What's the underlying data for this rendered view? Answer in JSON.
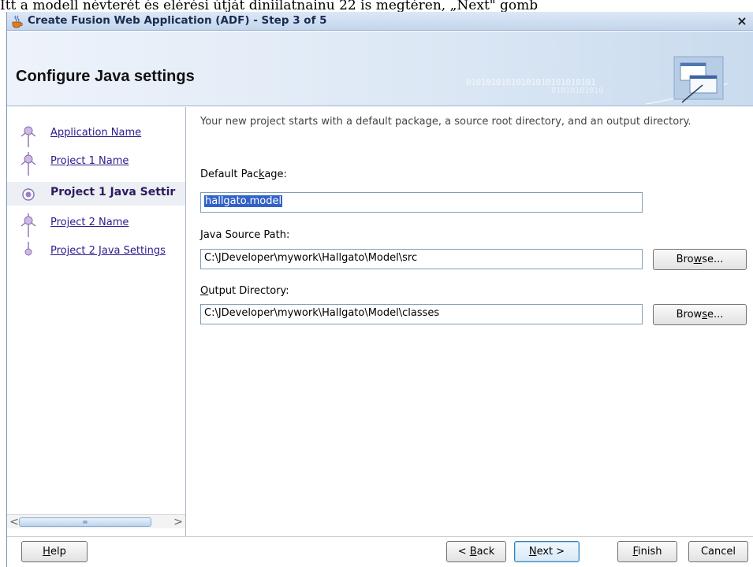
{
  "page_strip": "Itt a modell névterét és elérési útját diniilatnainu 22 is megtéren, „Next\" gomb",
  "window": {
    "title": "Create Fusion Web Application (ADF) - Step 3 of 5",
    "close_glyph": "×"
  },
  "header": {
    "title": "Configure Java settings",
    "binary_line1": "01010101010101010101010101",
    "binary_line2": "01010101010"
  },
  "nav": {
    "items": [
      {
        "label": "Application Name",
        "state": "done"
      },
      {
        "label": "Project 1 Name",
        "state": "done"
      },
      {
        "label": "Project 1 Java Settir",
        "state": "current"
      },
      {
        "label": "Project 2 Name",
        "state": "done"
      },
      {
        "label": "Project 2 Java Settings",
        "state": "pending"
      }
    ],
    "scroll_left": "<",
    "scroll_right": ">"
  },
  "content": {
    "description": "Your new project starts with a default package, a source root directory, and an output directory.",
    "default_package": {
      "label_before": "Default Pac",
      "label_mnemonic": "k",
      "label_after": "age:",
      "value": "hallgato.model"
    },
    "java_source_path": {
      "label_mnemonic": "J",
      "label_after": "ava Source Path:",
      "value": "C:\\JDeveloper\\mywork\\Hallgato\\Model\\src",
      "browse_before": "Bro",
      "browse_mnemonic": "w",
      "browse_after": "se..."
    },
    "output_directory": {
      "label_mnemonic": "O",
      "label_after": "utput Directory:",
      "value": "C:\\JDeveloper\\mywork\\Hallgato\\Model\\classes",
      "browse_before": "Brow",
      "browse_mnemonic": "s",
      "browse_after": "e..."
    }
  },
  "footer": {
    "help": {
      "mnemonic": "H",
      "rest": "elp"
    },
    "back": {
      "before": "< ",
      "mnemonic": "B",
      "rest": "ack"
    },
    "next": {
      "mnemonic": "N",
      "rest": "ext >"
    },
    "finish": {
      "mnemonic": "F",
      "rest": "inish"
    },
    "cancel": {
      "label": "Cancel"
    }
  },
  "colors": {
    "link": "#2c1b8c",
    "selection": "#3162c8",
    "header_gradient_end": "#c9dbee"
  }
}
